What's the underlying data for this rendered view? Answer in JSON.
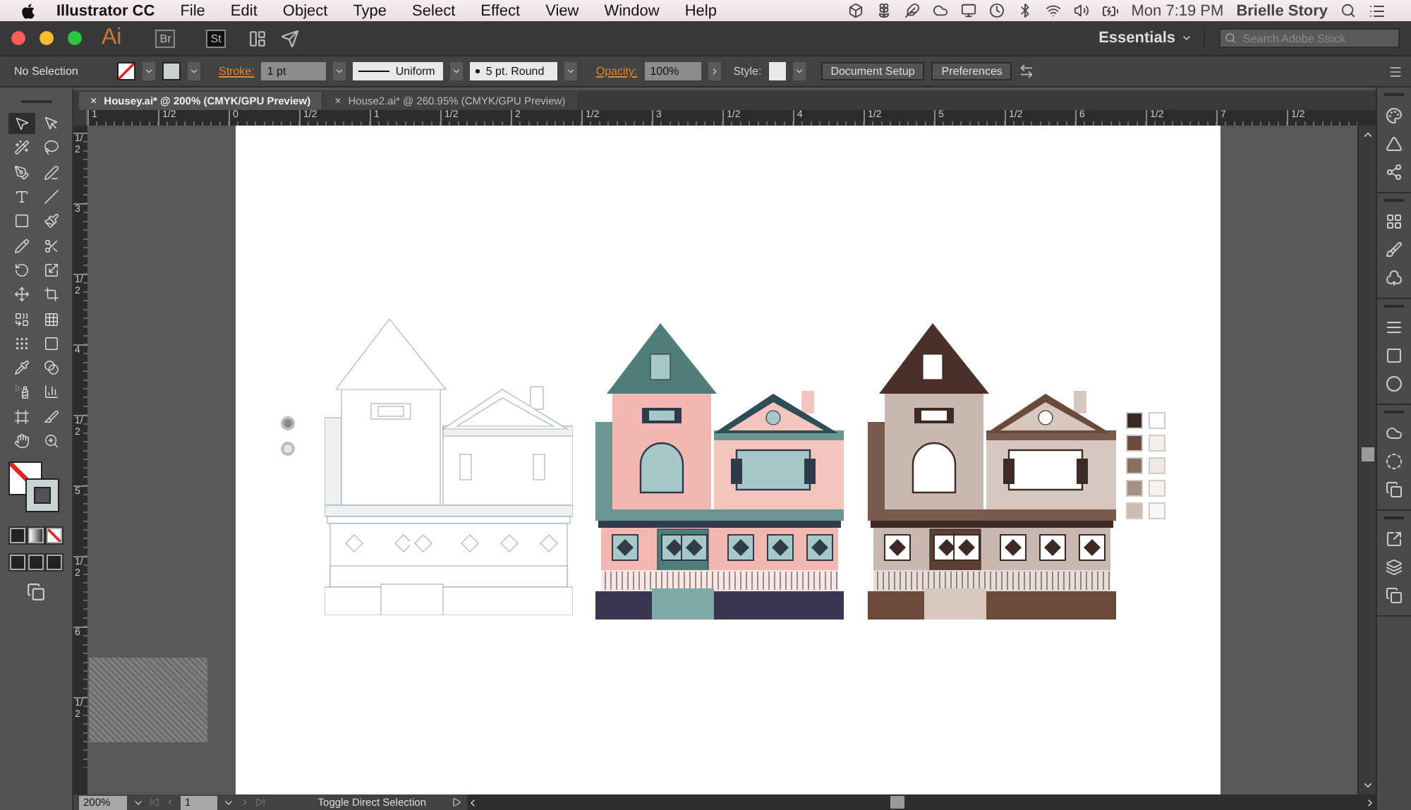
{
  "menu_bar": {
    "app_name": "Illustrator CC",
    "menus": [
      "File",
      "Edit",
      "Object",
      "Type",
      "Select",
      "Effect",
      "View",
      "Window",
      "Help"
    ],
    "clock": "Mon 7:19 PM",
    "user": "Brielle Story"
  },
  "title_bar": {
    "app_logo": "Ai",
    "bridge_badge": "Br",
    "stock_badge": "St",
    "workspace": "Essentials",
    "search": {
      "placeholder": "Search Adobe Stock"
    }
  },
  "control_bar": {
    "selection": "No Selection",
    "stroke_label": "Stroke:",
    "stroke_weight": "1 pt",
    "profile": "Uniform",
    "brush": "5 pt. Round",
    "opacity_label": "Opacity:",
    "opacity": "100%",
    "style_label": "Style:",
    "buttons": [
      "Document Setup",
      "Preferences"
    ]
  },
  "tabs": [
    {
      "label": "Housey.ai* @ 200% (CMYK/GPU Preview)",
      "close_glyph": "×",
      "selected": true
    },
    {
      "label": "House2.ai* @ 260.95% (CMYK/GPU Preview)",
      "close_glyph": "×",
      "selected": false
    }
  ],
  "ruler": {
    "horizontal": [
      "1",
      "1/2",
      "0",
      "1/2",
      "1",
      "1/2",
      "2",
      "1/2",
      "3",
      "1/2",
      "4",
      "1/2",
      "5",
      "1/2",
      "6",
      "1/2",
      "7",
      "1/2"
    ],
    "vertical": [
      "1/2",
      "3",
      "1/2",
      "4",
      "1/2",
      "5",
      "1/2",
      "6",
      "1/2"
    ]
  },
  "toolbar": {
    "tools": [
      {
        "kind": "selection",
        "selected": true
      },
      {
        "kind": "direct",
        "selected": false
      },
      {
        "kind": "wand",
        "selected": false
      },
      {
        "kind": "lasso",
        "selected": false
      },
      {
        "kind": "pen",
        "selected": false
      },
      {
        "kind": "curvature",
        "selected": false
      },
      {
        "kind": "type",
        "selected": false
      },
      {
        "kind": "line",
        "selected": false
      },
      {
        "kind": "rectangle",
        "selected": false
      },
      {
        "kind": "paintbrush",
        "selected": false
      },
      {
        "kind": "shaper",
        "selected": false
      },
      {
        "kind": "scissors",
        "selected": false
      },
      {
        "kind": "rotate",
        "selected": false
      },
      {
        "kind": "scale",
        "selected": false
      },
      {
        "kind": "puppet",
        "selected": false
      },
      {
        "kind": "transform",
        "selected": false
      },
      {
        "kind": "builder",
        "selected": false
      },
      {
        "kind": "perspective",
        "selected": false
      },
      {
        "kind": "mesh",
        "selected": false
      },
      {
        "kind": "gradient",
        "selected": false
      },
      {
        "kind": "eyedropper",
        "selected": false
      },
      {
        "kind": "blend",
        "selected": false
      },
      {
        "kind": "sprayer",
        "selected": false
      },
      {
        "kind": "graph",
        "selected": false
      },
      {
        "kind": "artboard",
        "selected": false
      },
      {
        "kind": "slice",
        "selected": false
      },
      {
        "kind": "hand",
        "selected": false
      },
      {
        "kind": "zoom",
        "selected": false
      }
    ]
  },
  "status_bar": {
    "zoom": "200%",
    "artboard": "1",
    "status": "Toggle Direct Selection"
  }
}
